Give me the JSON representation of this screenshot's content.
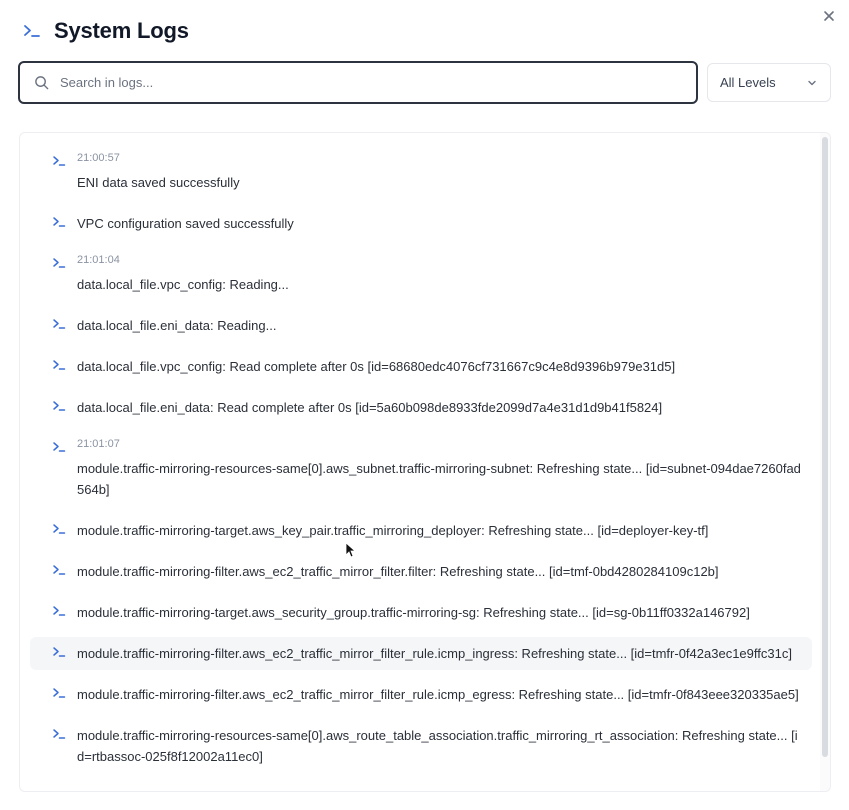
{
  "header": {
    "title": "System Logs"
  },
  "search": {
    "placeholder": "Search in logs..."
  },
  "level_filter": {
    "selected": "All Levels"
  },
  "logs": [
    {
      "timestamp": "21:00:57",
      "message": "ENI data saved successfully"
    },
    {
      "timestamp": "",
      "message": "VPC configuration saved successfully"
    },
    {
      "timestamp": "21:01:04",
      "message": "data.local_file.vpc_config: Reading..."
    },
    {
      "timestamp": "",
      "message": "data.local_file.eni_data: Reading..."
    },
    {
      "timestamp": "",
      "message": "data.local_file.vpc_config: Read complete after 0s [id=68680edc4076cf731667c9c4e8d9396b979e31d5]"
    },
    {
      "timestamp": "",
      "message": "data.local_file.eni_data: Read complete after 0s [id=5a60b098de8933fde2099d7a4e31d1d9b41f5824]"
    },
    {
      "timestamp": "21:01:07",
      "message": "module.traffic-mirroring-resources-same[0].aws_subnet.traffic-mirroring-subnet: Refreshing state... [id=subnet-094dae7260fad564b]"
    },
    {
      "timestamp": "",
      "message": "module.traffic-mirroring-target.aws_key_pair.traffic_mirroring_deployer: Refreshing state... [id=deployer-key-tf]"
    },
    {
      "timestamp": "",
      "message": "module.traffic-mirroring-filter.aws_ec2_traffic_mirror_filter.filter: Refreshing state... [id=tmf-0bd4280284109c12b]"
    },
    {
      "timestamp": "",
      "message": "module.traffic-mirroring-target.aws_security_group.traffic-mirroring-sg: Refreshing state... [id=sg-0b11ff0332a146792]"
    },
    {
      "timestamp": "",
      "message": "module.traffic-mirroring-filter.aws_ec2_traffic_mirror_filter_rule.icmp_ingress: Refreshing state... [id=tmfr-0f42a3ec1e9ffc31c]"
    },
    {
      "timestamp": "",
      "message": "module.traffic-mirroring-filter.aws_ec2_traffic_mirror_filter_rule.icmp_egress: Refreshing state... [id=tmfr-0f843eee320335ae5]"
    },
    {
      "timestamp": "",
      "message": "module.traffic-mirroring-resources-same[0].aws_route_table_association.traffic_mirroring_rt_association: Refreshing state... [id=rtbassoc-025f8f12002a11ec0]"
    }
  ],
  "colors": {
    "accent": "#3b6fd8",
    "text": "#2a2f38",
    "timestamp": "#8a93a2",
    "highlight_row": "#f5f6f8"
  },
  "icons": {
    "close": "close-icon",
    "title": "terminal-icon",
    "search": "search-icon",
    "select": "chevron-down-icon",
    "log": "terminal-icon"
  }
}
